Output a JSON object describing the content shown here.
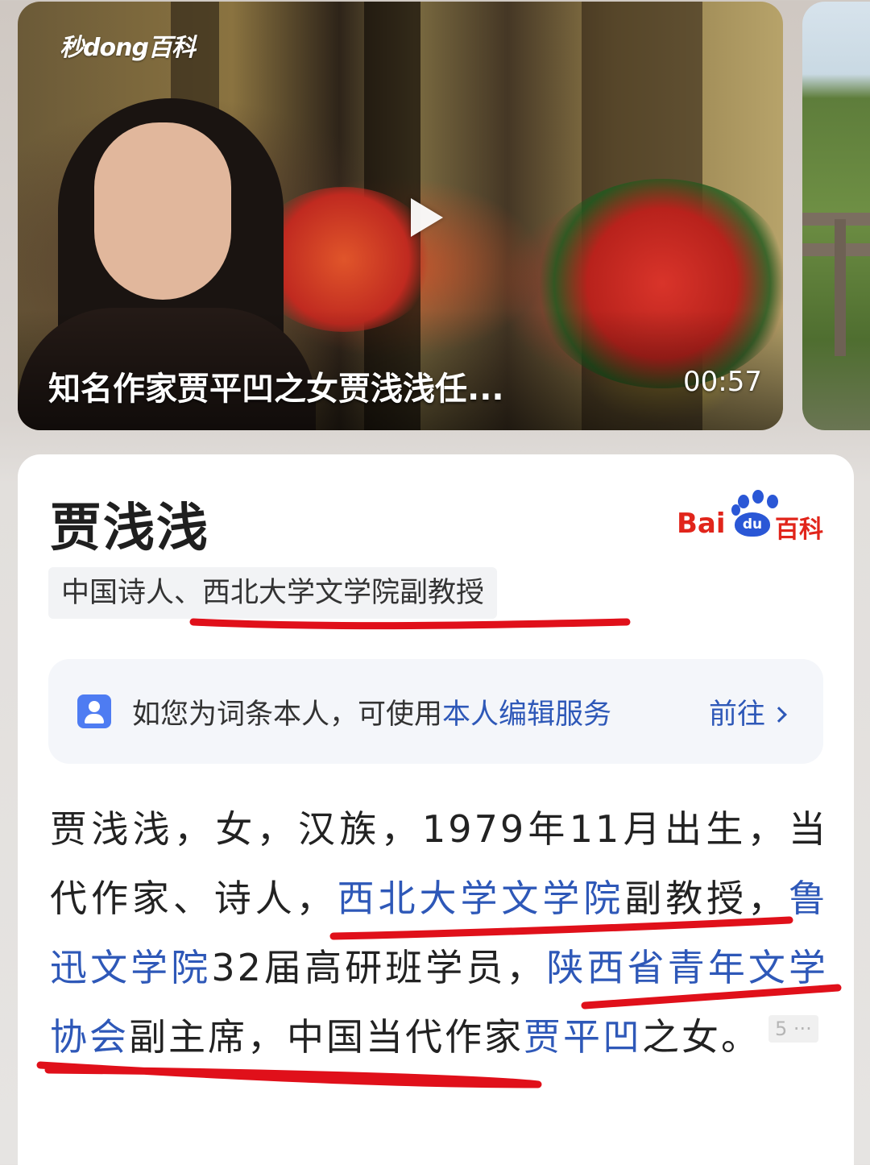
{
  "video": {
    "watermark": "秒dong百科",
    "title": "知名作家贾平凹之女贾浅浅任...",
    "duration": "00:57"
  },
  "entry": {
    "title": "贾浅浅",
    "logo_bai": "Bai",
    "logo_du": "du",
    "logo_baike": "百科",
    "subtitle": "中国诗人、西北大学文学院副教授",
    "edit_banner": {
      "prefix": "如您为词条本人，可使用",
      "link": "本人编辑服务",
      "goto": "前往"
    },
    "intro": {
      "t1": "贾浅浅，女，汉族，1979年11月出生，当代作家、诗人，",
      "l1": "西北大学文学院",
      "t2": "副教授，",
      "l2": "鲁迅文学院",
      "t3": "32届高研班学员，",
      "l3": "陕西省青年文学协会",
      "t4": "副主席，中国当代作家",
      "l4": "贾平凹",
      "t5": "之女。",
      "ref": "5 ···"
    }
  },
  "colors": {
    "link": "#2e58b8",
    "brand_red": "#e1251b",
    "brand_blue": "#2a57d6",
    "annotation_red": "#e0101a"
  }
}
